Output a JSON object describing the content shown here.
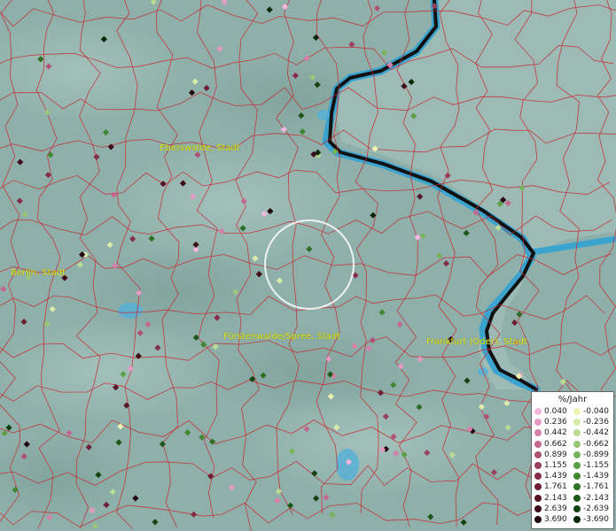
{
  "map": {
    "city_labels": [
      "Eberswalde, Stadt",
      "Berlin, Stadt",
      "Fürstenwalde/Spree, Stadt",
      "Frankfurt (Oder), Stadt"
    ]
  },
  "legend": {
    "title": "%/Jahr",
    "positive": [
      {
        "label": "0.040",
        "color": "#f4b6dc"
      },
      {
        "label": "0.236",
        "color": "#e59ac4"
      },
      {
        "label": "0.442",
        "color": "#d580ab"
      },
      {
        "label": "0.662",
        "color": "#c46890"
      },
      {
        "label": "0.899",
        "color": "#b05273"
      },
      {
        "label": "1.155",
        "color": "#9c3f5c"
      },
      {
        "label": "1.439",
        "color": "#862d47"
      },
      {
        "label": "1.761",
        "color": "#6e1f33"
      },
      {
        "label": "2.143",
        "color": "#561424"
      },
      {
        "label": "2.639",
        "color": "#3e0b17"
      },
      {
        "label": "3.690",
        "color": "#22040b"
      }
    ],
    "negative": [
      {
        "label": "-0.040",
        "color": "#eef2b0"
      },
      {
        "label": "-0.236",
        "color": "#d8ebaa"
      },
      {
        "label": "-0.442",
        "color": "#b9dc92"
      },
      {
        "label": "-0.662",
        "color": "#97c877"
      },
      {
        "label": "-0.899",
        "color": "#76b45c"
      },
      {
        "label": "-1.155",
        "color": "#5a9e45"
      },
      {
        "label": "-1.439",
        "color": "#418733"
      },
      {
        "label": "-1.761",
        "color": "#2d6f25"
      },
      {
        "label": "-2.143",
        "color": "#1e5819"
      },
      {
        "label": "-2.639",
        "color": "#12420f"
      },
      {
        "label": "-3.690",
        "color": "#062806"
      }
    ]
  }
}
